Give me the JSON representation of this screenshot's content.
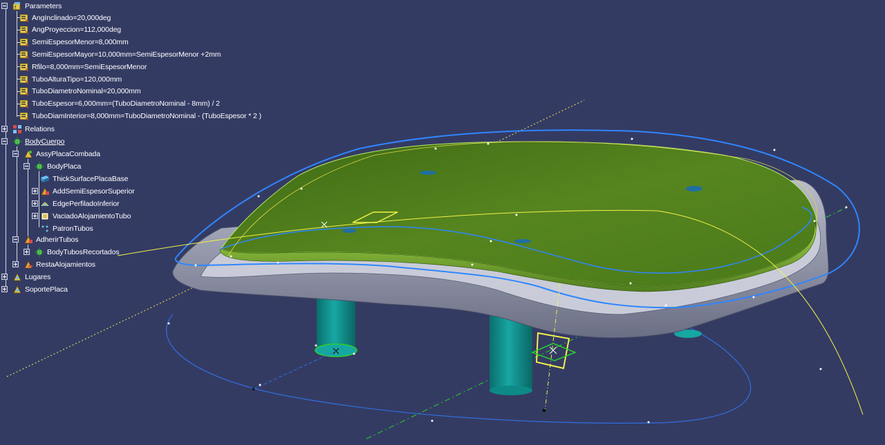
{
  "tree": {
    "parameters": {
      "label": "Parameters",
      "items": [
        "AngInclinado=20,000deg",
        "AngProyeccion=112,000deg",
        "SemiEspesorMenor=8,000mm",
        "SemiEspesorMayor=10,000mm=SemiEspesorMenor +2mm",
        "Rfilo=8,000mm=SemiEspesorMenor",
        "TuboAlturaTipo=120,000mm",
        "TuboDiametroNominal=20,000mm",
        "TuboEspesor=6,000mm=(TuboDiametroNominal - 8mm) / 2",
        "TuboDiamInterior=8,000mm=TuboDiametroNominal - (TuboEspesor * 2 )"
      ]
    },
    "relations": "Relations",
    "bodycuerpo": "BodyCuerpo",
    "assyplacacombada": "AssyPlacaCombada",
    "bodyplaca": "BodyPlaca",
    "thicksurface": "ThickSurfacePlacaBase",
    "addsemi": "AddSemiEspesorSuperior",
    "edgeperfilado": "EdgePerfiladoInferior",
    "vaciado": "VaciadoAlojamientoTubo",
    "patron": "PatronTubos",
    "adherir": "AdherirTubos",
    "bodytubos": "BodyTubosRecortados",
    "resta": "RestaAlojamientos",
    "lugares": "Lugares",
    "soporte": "SoportePlaca"
  },
  "colors": {
    "background": "#343b63",
    "plate_top": "#4d7a1f",
    "plate_side": "#8e93a8",
    "tubes": "#0e8a87",
    "sketch_blue": "#2f86ff",
    "construction_yellow": "#f2f24a",
    "axis_green": "#2bd12b"
  }
}
